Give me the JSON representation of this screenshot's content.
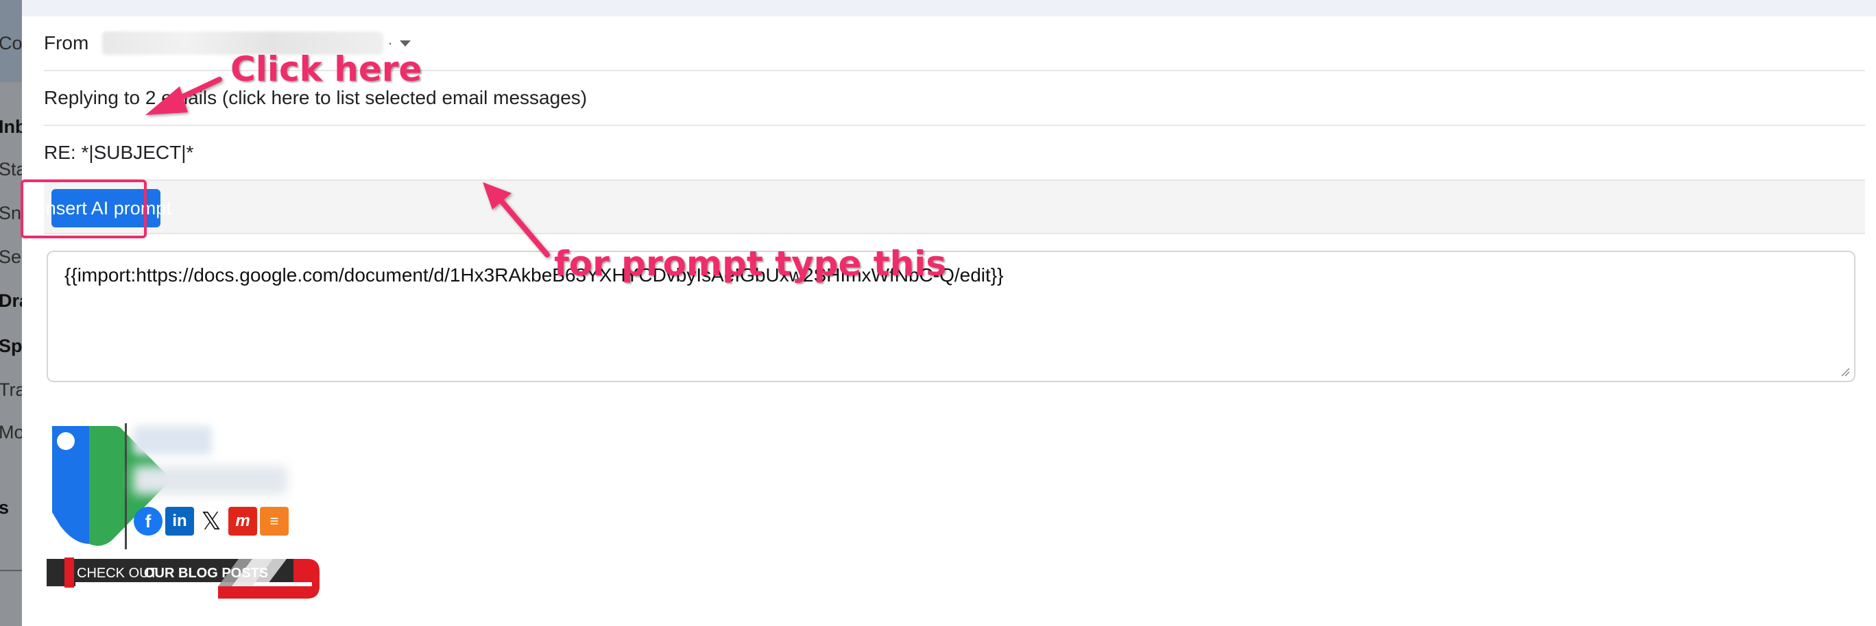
{
  "sidebar": {
    "items": [
      {
        "label": "Co",
        "bold": false
      },
      {
        "label": "Inb",
        "bold": true
      },
      {
        "label": "Sta",
        "bold": false
      },
      {
        "label": "Sno",
        "bold": false
      },
      {
        "label": "Ser",
        "bold": false
      },
      {
        "label": "Dra",
        "bold": true
      },
      {
        "label": "Spa",
        "bold": true
      },
      {
        "label": "Tra",
        "bold": false
      },
      {
        "label": "Mo",
        "bold": false
      },
      {
        "label": "s",
        "bold": true
      }
    ]
  },
  "compose": {
    "from_label": "From",
    "reply_text": "Replying to 2 emails (click here to list selected email messages)",
    "subject": "RE: *|SUBJECT|*",
    "ai_button_label": "Insert AI prompt",
    "prompt_value": "{{import:https://docs.google.com/document/d/1Hx3RAkbeB63YXHYCDvbyIsAeIGbUxw2SHImxWfNbC-Q/edit}}"
  },
  "signature": {
    "social_icons": [
      "facebook-icon",
      "linkedin-icon",
      "x-icon",
      "meetup-icon",
      "stack-icon"
    ],
    "banner_text_light": "CHECK OUT",
    "banner_text_bold": "OUR BLOG POSTS"
  },
  "annotations": {
    "click_here": "Click here",
    "for_prompt": "for prompt type this",
    "color": "#ee2d6a"
  },
  "colors": {
    "button_blue": "#1a73e8",
    "annotation_pink": "#ee2d6a"
  }
}
